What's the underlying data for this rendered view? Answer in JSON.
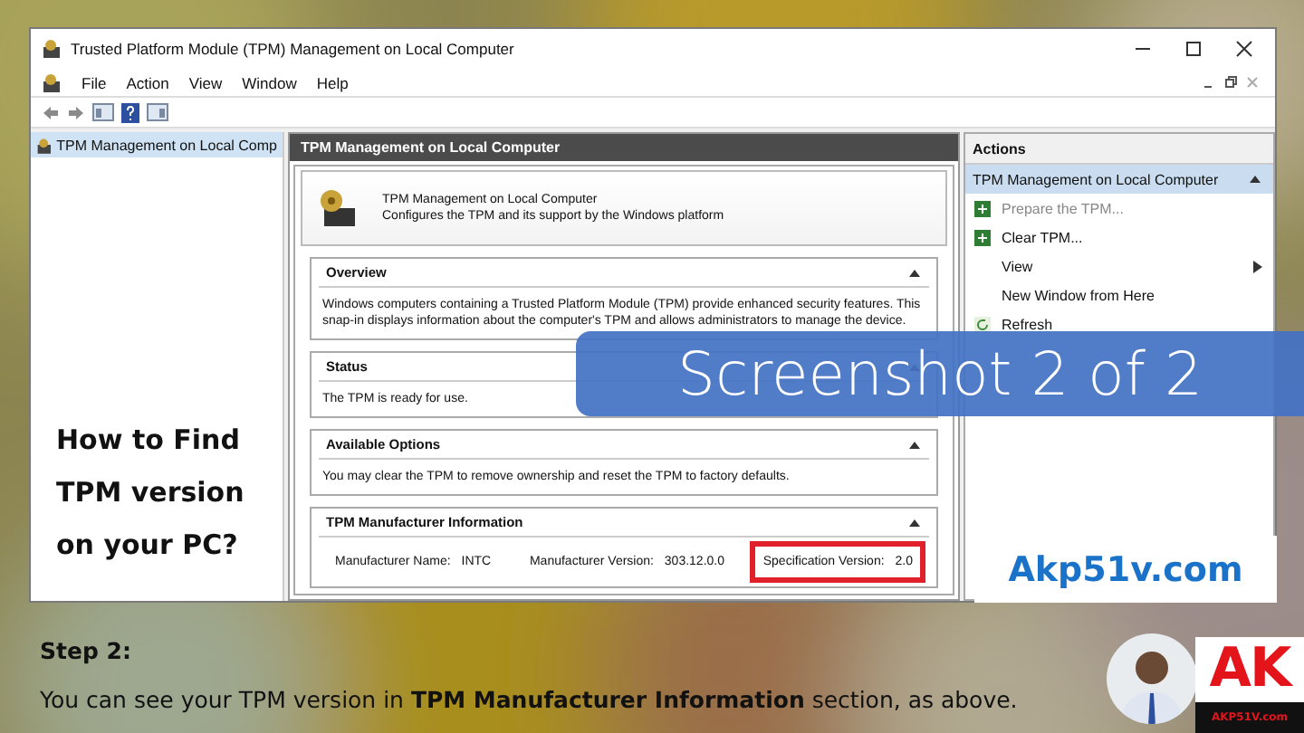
{
  "window": {
    "title": "Trusted Platform Module (TPM) Management on Local Computer",
    "menu": [
      "File",
      "Action",
      "View",
      "Window",
      "Help"
    ],
    "tree": [
      {
        "label": "TPM Management on Local Comp",
        "selected": true
      }
    ],
    "center": {
      "header": "TPM Management on Local Computer",
      "intro": {
        "title": "TPM Management on Local Computer",
        "description": "Configures the TPM and its support by the Windows platform"
      },
      "sections": [
        {
          "kind": "text",
          "title": "Overview",
          "text": "Windows computers containing a Trusted Platform Module (TPM) provide enhanced security features. This snap-in displays information about the computer's TPM and allows administrators to manage the device."
        },
        {
          "kind": "text",
          "title": "Status",
          "text": "The TPM is ready for use."
        },
        {
          "kind": "text",
          "title": "Available Options",
          "text": "You may clear the TPM to remove ownership and reset the TPM to factory defaults."
        },
        {
          "kind": "fields",
          "title": "TPM Manufacturer Information",
          "fields": [
            {
              "label": "Manufacturer Name:",
              "value": "INTC",
              "highlighted": false
            },
            {
              "label": "Manufacturer Version:",
              "value": "303.12.0.0",
              "highlighted": false
            },
            {
              "label": "Specification Version:",
              "value": "2.0",
              "highlighted": true
            }
          ]
        }
      ]
    },
    "actions": {
      "title": "Actions",
      "group": "TPM Management on Local Computer",
      "items": [
        {
          "kind": "task",
          "label": "Prepare the TPM...",
          "disabled": true
        },
        {
          "kind": "task",
          "label": "Clear TPM...",
          "disabled": false
        },
        {
          "kind": "submenu",
          "label": "View",
          "disabled": false
        },
        {
          "kind": "plain",
          "label": "New Window from Here",
          "disabled": false
        },
        {
          "kind": "refresh",
          "label": "Refresh",
          "disabled": false
        }
      ]
    }
  },
  "banner": "Screenshot 2 of 2",
  "side_title": "How to Find TPM version on your PC?",
  "site": "Akp51v.com",
  "step": {
    "heading": "Step 2:",
    "text": "You can see your TPM version in **TPM Manufacturer Information** section, as above."
  },
  "logo": {
    "text": "AK",
    "subtext": "AKP51V.com"
  }
}
